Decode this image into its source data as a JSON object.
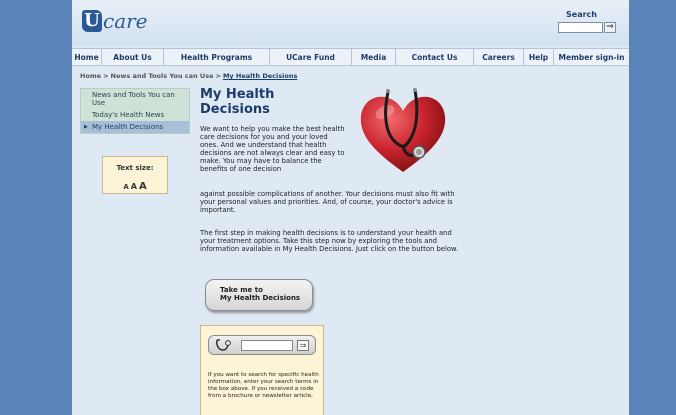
{
  "header": {
    "logo_initial": "U",
    "logo_rest": "care",
    "search_label": "Search",
    "search_placeholder": "",
    "search_go": "⇒"
  },
  "nav": {
    "items": [
      "Home",
      "About Us",
      "Health Programs",
      "UCare Fund",
      "Media",
      "Contact Us",
      "Careers",
      "Help",
      "Member sign-in"
    ]
  },
  "breadcrumb": {
    "items": [
      "Home",
      "News and Tools You can Use",
      "My Health Decisions"
    ],
    "separator": ">"
  },
  "left_nav": {
    "items": [
      "News and Tools You can Use",
      "Today's Health News",
      "My Health Decisions"
    ],
    "active_index": 2
  },
  "text_size": {
    "label": "Text size:",
    "small": "A",
    "medium": "A",
    "large": "A"
  },
  "main": {
    "title": "My Health Decisions",
    "para1a": "We want to help you make the best health care decisions for you and your loved ones. And we understand that health decisions are not always clear and easy to make. You may have to balance the benefits of one decision",
    "para1b": "against possible complications of another. Your decisions must also fit with your personal values and priorities. And, of course, your doctor's advice is important.",
    "para2": "The first step in making health decisions is to understand your health and your treatment options. Take this step now by exploring the tools and information available in My Health Decisions. Just click on the button below.",
    "cta_line1": "Take me to",
    "cta_line2": "My Health Decisions"
  },
  "search_box": {
    "input_value": "",
    "go": "⇒",
    "help_text": "If you want to search for specific health information, enter your search terms in the box above. If you received a code from a brochure or newsletter article,"
  },
  "colors": {
    "background": "#5a83b8",
    "page": "#dfe9f4",
    "brand_blue": "#1c3d6c",
    "nav_bg": "#edf2f8",
    "leftnav_bg": "#cfe2d8",
    "leftnav_active": "#a8bfd8",
    "panel_cream": "#fdf4d8",
    "heart_red": "#c8232c"
  },
  "icons": {
    "heart": "heart-stethoscope-icon",
    "search_tool": "stethoscope-icon",
    "go": "arrow-right-icon"
  }
}
